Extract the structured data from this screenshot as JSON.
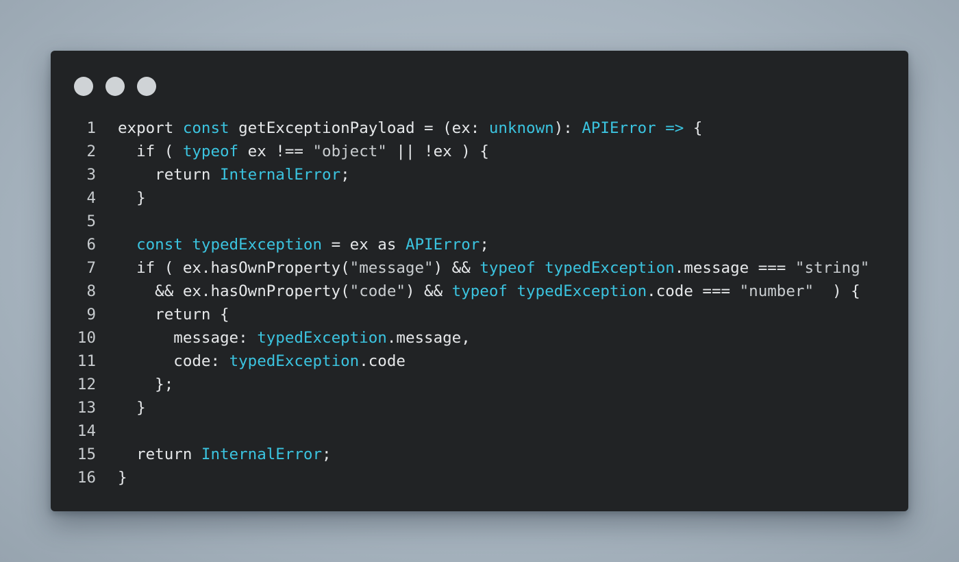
{
  "window": {
    "traffic_lights": [
      "dot",
      "dot",
      "dot"
    ]
  },
  "code": {
    "lines": [
      {
        "num": "1",
        "tokens": [
          {
            "t": "export ",
            "c": "plain"
          },
          {
            "t": "const",
            "c": "type"
          },
          {
            "t": " getExceptionPayload = (ex: ",
            "c": "plain"
          },
          {
            "t": "unknown",
            "c": "type"
          },
          {
            "t": "): ",
            "c": "plain"
          },
          {
            "t": "APIError",
            "c": "type"
          },
          {
            "t": " ",
            "c": "plain"
          },
          {
            "t": "=>",
            "c": "type"
          },
          {
            "t": " {",
            "c": "plain"
          }
        ]
      },
      {
        "num": "2",
        "tokens": [
          {
            "t": "  if ( ",
            "c": "plain"
          },
          {
            "t": "typeof",
            "c": "type"
          },
          {
            "t": " ex !== ",
            "c": "plain"
          },
          {
            "t": "\"object\"",
            "c": "str"
          },
          {
            "t": " || !ex ) {",
            "c": "plain"
          }
        ]
      },
      {
        "num": "3",
        "tokens": [
          {
            "t": "    return ",
            "c": "plain"
          },
          {
            "t": "InternalError",
            "c": "type"
          },
          {
            "t": ";",
            "c": "plain"
          }
        ]
      },
      {
        "num": "4",
        "tokens": [
          {
            "t": "  }",
            "c": "plain"
          }
        ]
      },
      {
        "num": "5",
        "tokens": []
      },
      {
        "num": "6",
        "tokens": [
          {
            "t": "  ",
            "c": "plain"
          },
          {
            "t": "const",
            "c": "type"
          },
          {
            "t": " ",
            "c": "plain"
          },
          {
            "t": "typedException",
            "c": "type"
          },
          {
            "t": " = ex as ",
            "c": "plain"
          },
          {
            "t": "APIError",
            "c": "type"
          },
          {
            "t": ";",
            "c": "plain"
          }
        ]
      },
      {
        "num": "7",
        "tokens": [
          {
            "t": "  if ( ex.hasOwnProperty(",
            "c": "plain"
          },
          {
            "t": "\"message\"",
            "c": "str"
          },
          {
            "t": ") && ",
            "c": "plain"
          },
          {
            "t": "typeof",
            "c": "type"
          },
          {
            "t": " ",
            "c": "plain"
          },
          {
            "t": "typedException",
            "c": "type"
          },
          {
            "t": ".message === ",
            "c": "plain"
          },
          {
            "t": "\"string\"",
            "c": "str"
          }
        ]
      },
      {
        "num": "8",
        "tokens": [
          {
            "t": "    && ex.hasOwnProperty(",
            "c": "plain"
          },
          {
            "t": "\"code\"",
            "c": "str"
          },
          {
            "t": ") && ",
            "c": "plain"
          },
          {
            "t": "typeof",
            "c": "type"
          },
          {
            "t": " ",
            "c": "plain"
          },
          {
            "t": "typedException",
            "c": "type"
          },
          {
            "t": ".code === ",
            "c": "plain"
          },
          {
            "t": "\"number\"",
            "c": "str"
          },
          {
            "t": "  ) {",
            "c": "plain"
          }
        ]
      },
      {
        "num": "9",
        "tokens": [
          {
            "t": "    return {",
            "c": "plain"
          }
        ]
      },
      {
        "num": "10",
        "tokens": [
          {
            "t": "      message: ",
            "c": "plain"
          },
          {
            "t": "typedException",
            "c": "type"
          },
          {
            "t": ".message,",
            "c": "plain"
          }
        ]
      },
      {
        "num": "11",
        "tokens": [
          {
            "t": "      code: ",
            "c": "plain"
          },
          {
            "t": "typedException",
            "c": "type"
          },
          {
            "t": ".code",
            "c": "plain"
          }
        ]
      },
      {
        "num": "12",
        "tokens": [
          {
            "t": "    };",
            "c": "plain"
          }
        ]
      },
      {
        "num": "13",
        "tokens": [
          {
            "t": "  }",
            "c": "plain"
          }
        ]
      },
      {
        "num": "14",
        "tokens": []
      },
      {
        "num": "15",
        "tokens": [
          {
            "t": "  return ",
            "c": "plain"
          },
          {
            "t": "InternalError",
            "c": "type"
          },
          {
            "t": ";",
            "c": "plain"
          }
        ]
      },
      {
        "num": "16",
        "tokens": [
          {
            "t": "}",
            "c": "plain"
          }
        ]
      }
    ]
  },
  "colors": {
    "background": "#a9b6c1",
    "window_bg": "#212325",
    "highlight": "#3bc4e0",
    "text": "#e6e8ea",
    "dot": "#cfd3d6"
  }
}
